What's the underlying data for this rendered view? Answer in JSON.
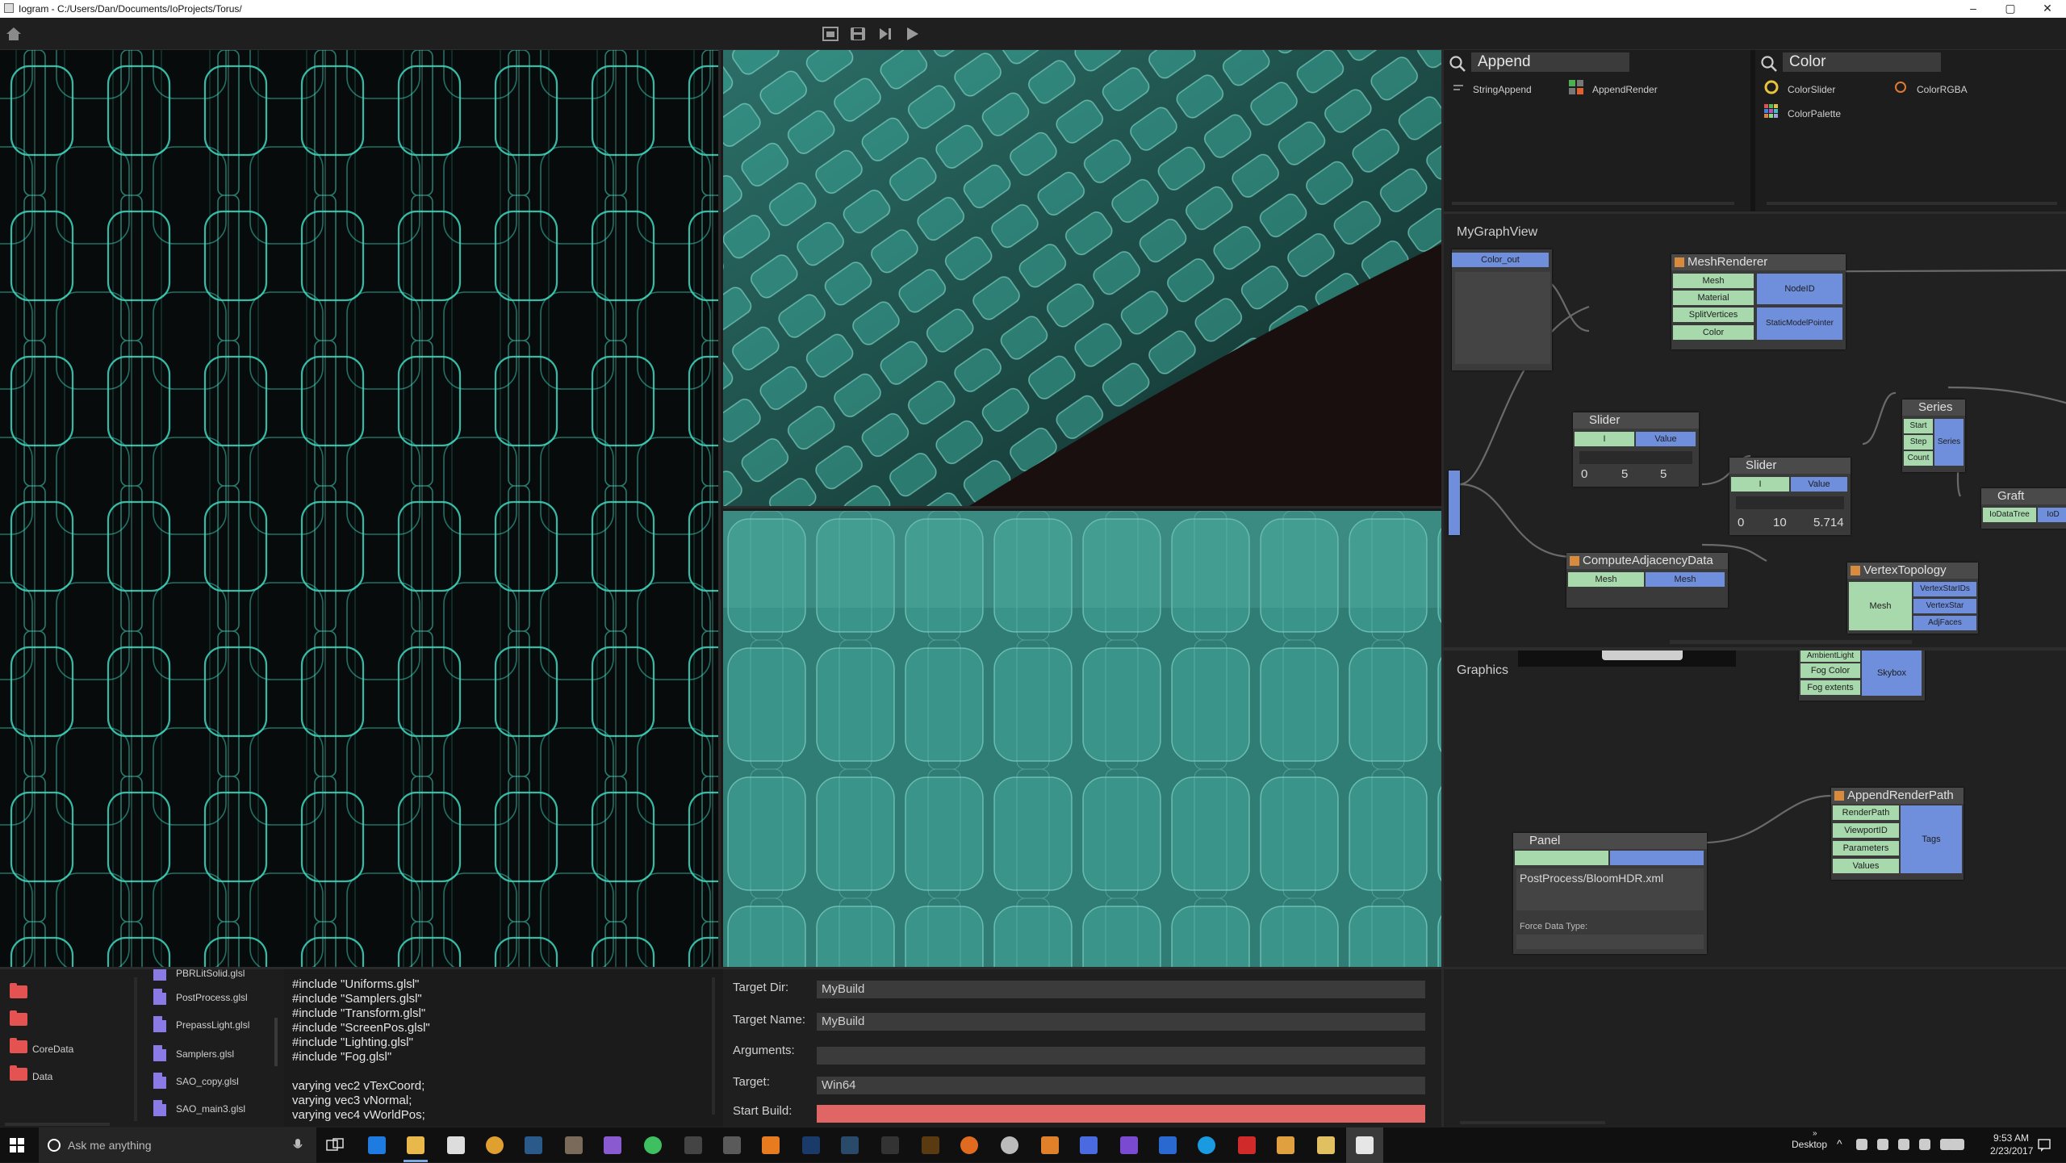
{
  "window": {
    "title": "Iogram - C:/Users/Dan/Documents/IoProjects/Torus/",
    "controls": [
      "–",
      "▢",
      "✕"
    ]
  },
  "toolbar": {
    "icons": [
      "home-icon",
      "new-file-icon",
      "save-icon",
      "step-icon",
      "play-icon"
    ]
  },
  "node_search": {
    "left": {
      "query": "Append",
      "results": [
        {
          "label": "StringAppend",
          "icon": "string-append-icon"
        },
        {
          "label": "AppendRender",
          "icon": "append-render-icon"
        }
      ]
    },
    "right": {
      "query": "Color",
      "results": [
        {
          "label": "ColorSlider",
          "icon": "color-slider-icon"
        },
        {
          "label": "ColorRGBA",
          "icon": "color-rgba-icon"
        },
        {
          "label": "ColorPalette",
          "icon": "color-palette-icon"
        }
      ]
    }
  },
  "graph": {
    "title": "MyGraphView",
    "color_out": "Color_out",
    "mesh_renderer": {
      "title": "MeshRenderer",
      "inputs": [
        "Mesh",
        "Material",
        "SplitVertices",
        "Color"
      ],
      "outputs": [
        "NodeID",
        "StaticModelPointer"
      ]
    },
    "slider1": {
      "title": "Slider",
      "input": "I",
      "output": "Value",
      "min": "0",
      "value": "5",
      "max": "5"
    },
    "slider2": {
      "title": "Slider",
      "input": "I",
      "output": "Value",
      "min": "0",
      "value": "10",
      "max": "5.714"
    },
    "series": {
      "title": "Series",
      "inputs": [
        "Start",
        "Step",
        "Count"
      ],
      "output": "Series"
    },
    "graft": {
      "title": "Graft",
      "input": "IoDataTree",
      "output": "IoD"
    },
    "compute_adjacency": {
      "title": "ComputeAdjacencyData",
      "input": "Mesh",
      "output": "Mesh"
    },
    "vertex_topology": {
      "title": "VertexTopology",
      "input": "Mesh",
      "outputs": [
        "VertexStarIDs",
        "VertexStar",
        "AdjFaces"
      ]
    }
  },
  "graphics": {
    "title": "Graphics",
    "skybox_inputs": [
      "AmbientLight",
      "Fog Color",
      "Fog extents"
    ],
    "skybox_output": "Skybox",
    "panel": {
      "title": "Panel",
      "text": "PostProcess/BloomHDR.xml",
      "force_label": "Force Data Type:"
    },
    "append_render_path": {
      "title": "AppendRenderPath",
      "inputs": [
        "RenderPath",
        "ViewportID",
        "Parameters",
        "Values"
      ],
      "output": "Tags"
    }
  },
  "file_tree": {
    "folders": [
      "",
      "",
      "CoreData",
      "Data"
    ]
  },
  "file_list": {
    "files": [
      "PBRLitSolid.glsl",
      "PostProcess.glsl",
      "PrepassLight.glsl",
      "Samplers.glsl",
      "SAO_copy.glsl",
      "SAO_main3.glsl"
    ]
  },
  "code": {
    "lines": [
      "#include \"Uniforms.glsl\"",
      "#include \"Samplers.glsl\"",
      "#include \"Transform.glsl\"",
      "#include \"ScreenPos.glsl\"",
      "#include \"Lighting.glsl\"",
      "#include \"Fog.glsl\"",
      "",
      "varying vec2 vTexCoord;",
      "varying vec3 vNormal;",
      "varying vec4 vWorldPos;"
    ]
  },
  "build": {
    "target_dir_label": "Target Dir:",
    "target_dir": "MyBuild",
    "target_name_label": "Target Name:",
    "target_name": "MyBuild",
    "arguments_label": "Arguments:",
    "arguments": "",
    "target_label": "Target:",
    "target": "Win64",
    "start_build_label": "Start Build:",
    "accent": "#e06666"
  },
  "taskbar": {
    "search_placeholder": "Ask me anything",
    "desktop_label": "Desktop",
    "time": "9:53 AM",
    "date": "2/23/2017"
  },
  "colors": {
    "wire": "#3fd8c0",
    "glass": "#2f8f84",
    "input_pin": "#a8d9ad",
    "output_pin": "#6f8fdc"
  }
}
